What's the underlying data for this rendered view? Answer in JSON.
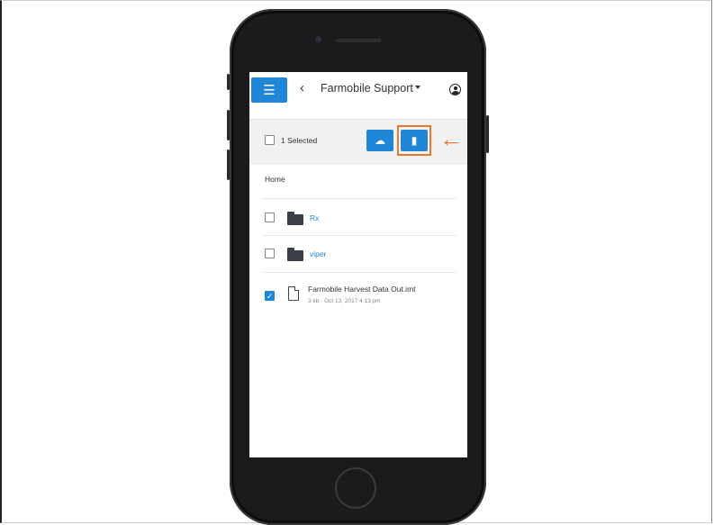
{
  "header": {
    "menu_icon": "hamburger-menu-icon",
    "back_icon": "chevron-left-icon",
    "account_name": "Farmobile Support",
    "account_caret_icon": "caret-down-icon",
    "profile_icon": "account-circle-icon"
  },
  "toolbar": {
    "selection_label": "1 Selected",
    "upload_icon": "cloud-upload-icon",
    "delete_icon": "trash-icon",
    "callout_color": "#e8782a"
  },
  "breadcrumb": "Home",
  "items": [
    {
      "type": "folder",
      "name": "Rx",
      "checked": false
    },
    {
      "type": "folder",
      "name": "viper",
      "checked": false
    },
    {
      "type": "file",
      "name": "Farmobile Harvest Data Out.imt",
      "size": "3 kb",
      "date": "Oct 13, 2017 4:13 pm",
      "checked": true
    }
  ],
  "colors": {
    "accent": "#1f86d8",
    "highlight": "#e8782a"
  }
}
